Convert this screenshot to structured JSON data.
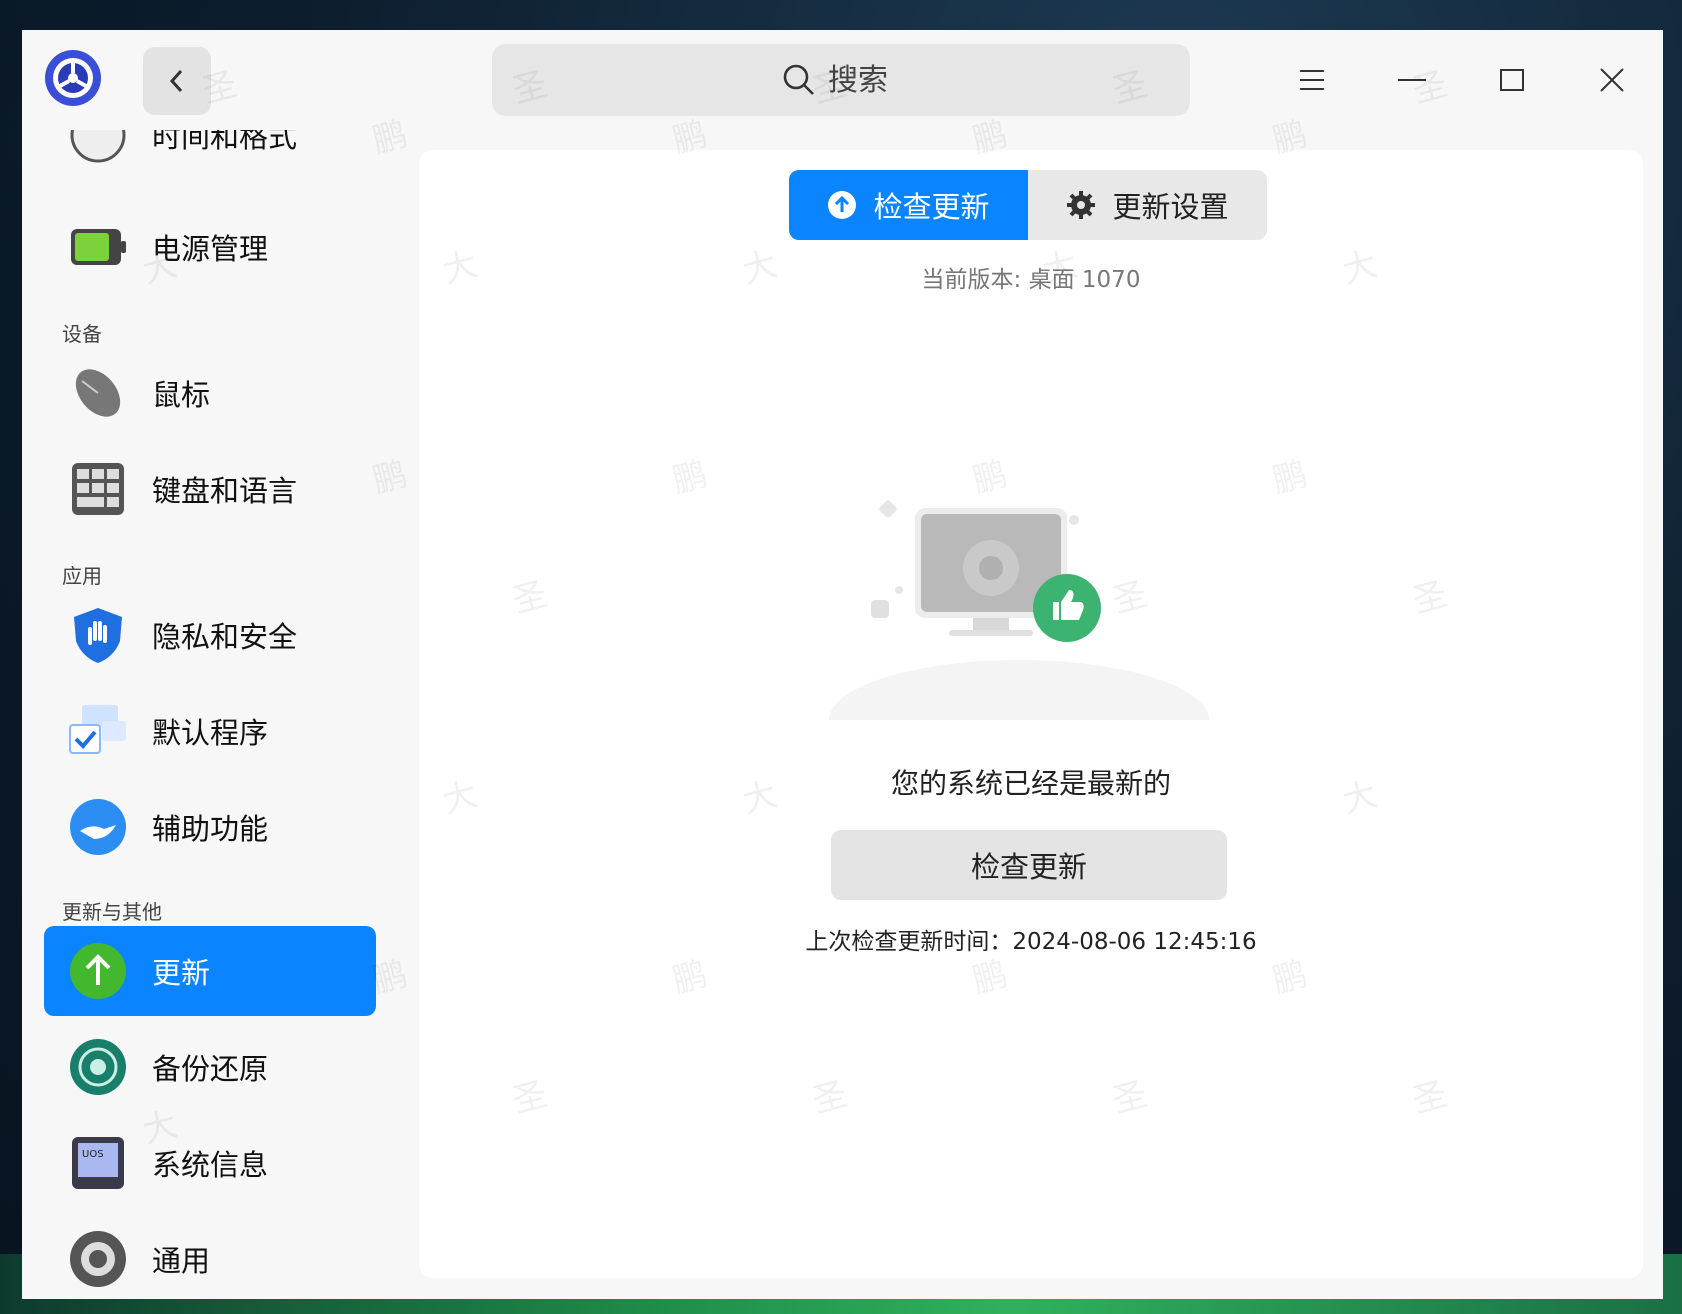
{
  "titlebar": {
    "search_placeholder": "搜索"
  },
  "sidebar": {
    "partial_item": "时间和格式",
    "items_top": [
      {
        "label": "电源管理",
        "icon": "battery-icon"
      }
    ],
    "section_devices": "设备",
    "items_devices": [
      {
        "label": "鼠标",
        "icon": "mouse-icon"
      },
      {
        "label": "键盘和语言",
        "icon": "keyboard-icon"
      }
    ],
    "section_apps": "应用",
    "items_apps": [
      {
        "label": "隐私和安全",
        "icon": "shield-icon"
      },
      {
        "label": "默认程序",
        "icon": "default-apps-icon"
      },
      {
        "label": "辅助功能",
        "icon": "accessibility-icon"
      }
    ],
    "section_update": "更新与其他",
    "items_update": [
      {
        "label": "更新",
        "icon": "update-arrow-icon",
        "active": true
      },
      {
        "label": "备份还原",
        "icon": "backup-icon"
      },
      {
        "label": "系统信息",
        "icon": "system-info-icon"
      },
      {
        "label": "通用",
        "icon": "general-gear-icon"
      }
    ]
  },
  "main": {
    "tabs": [
      {
        "label": "检查更新",
        "icon": "upload-circle-icon",
        "selected": true
      },
      {
        "label": "更新设置",
        "icon": "gear-icon",
        "selected": false
      }
    ],
    "version": "当前版本: 桌面 1070",
    "status": "您的系统已经是最新的",
    "check_button": "检查更新",
    "last_check": "上次检查更新时间：2024-08-06 12:45:16"
  },
  "colors": {
    "accent": "#0a84ff",
    "success_badge": "#3cb371"
  },
  "watermark": {
    "chars": [
      "鹏",
      "大",
      "圣"
    ]
  }
}
